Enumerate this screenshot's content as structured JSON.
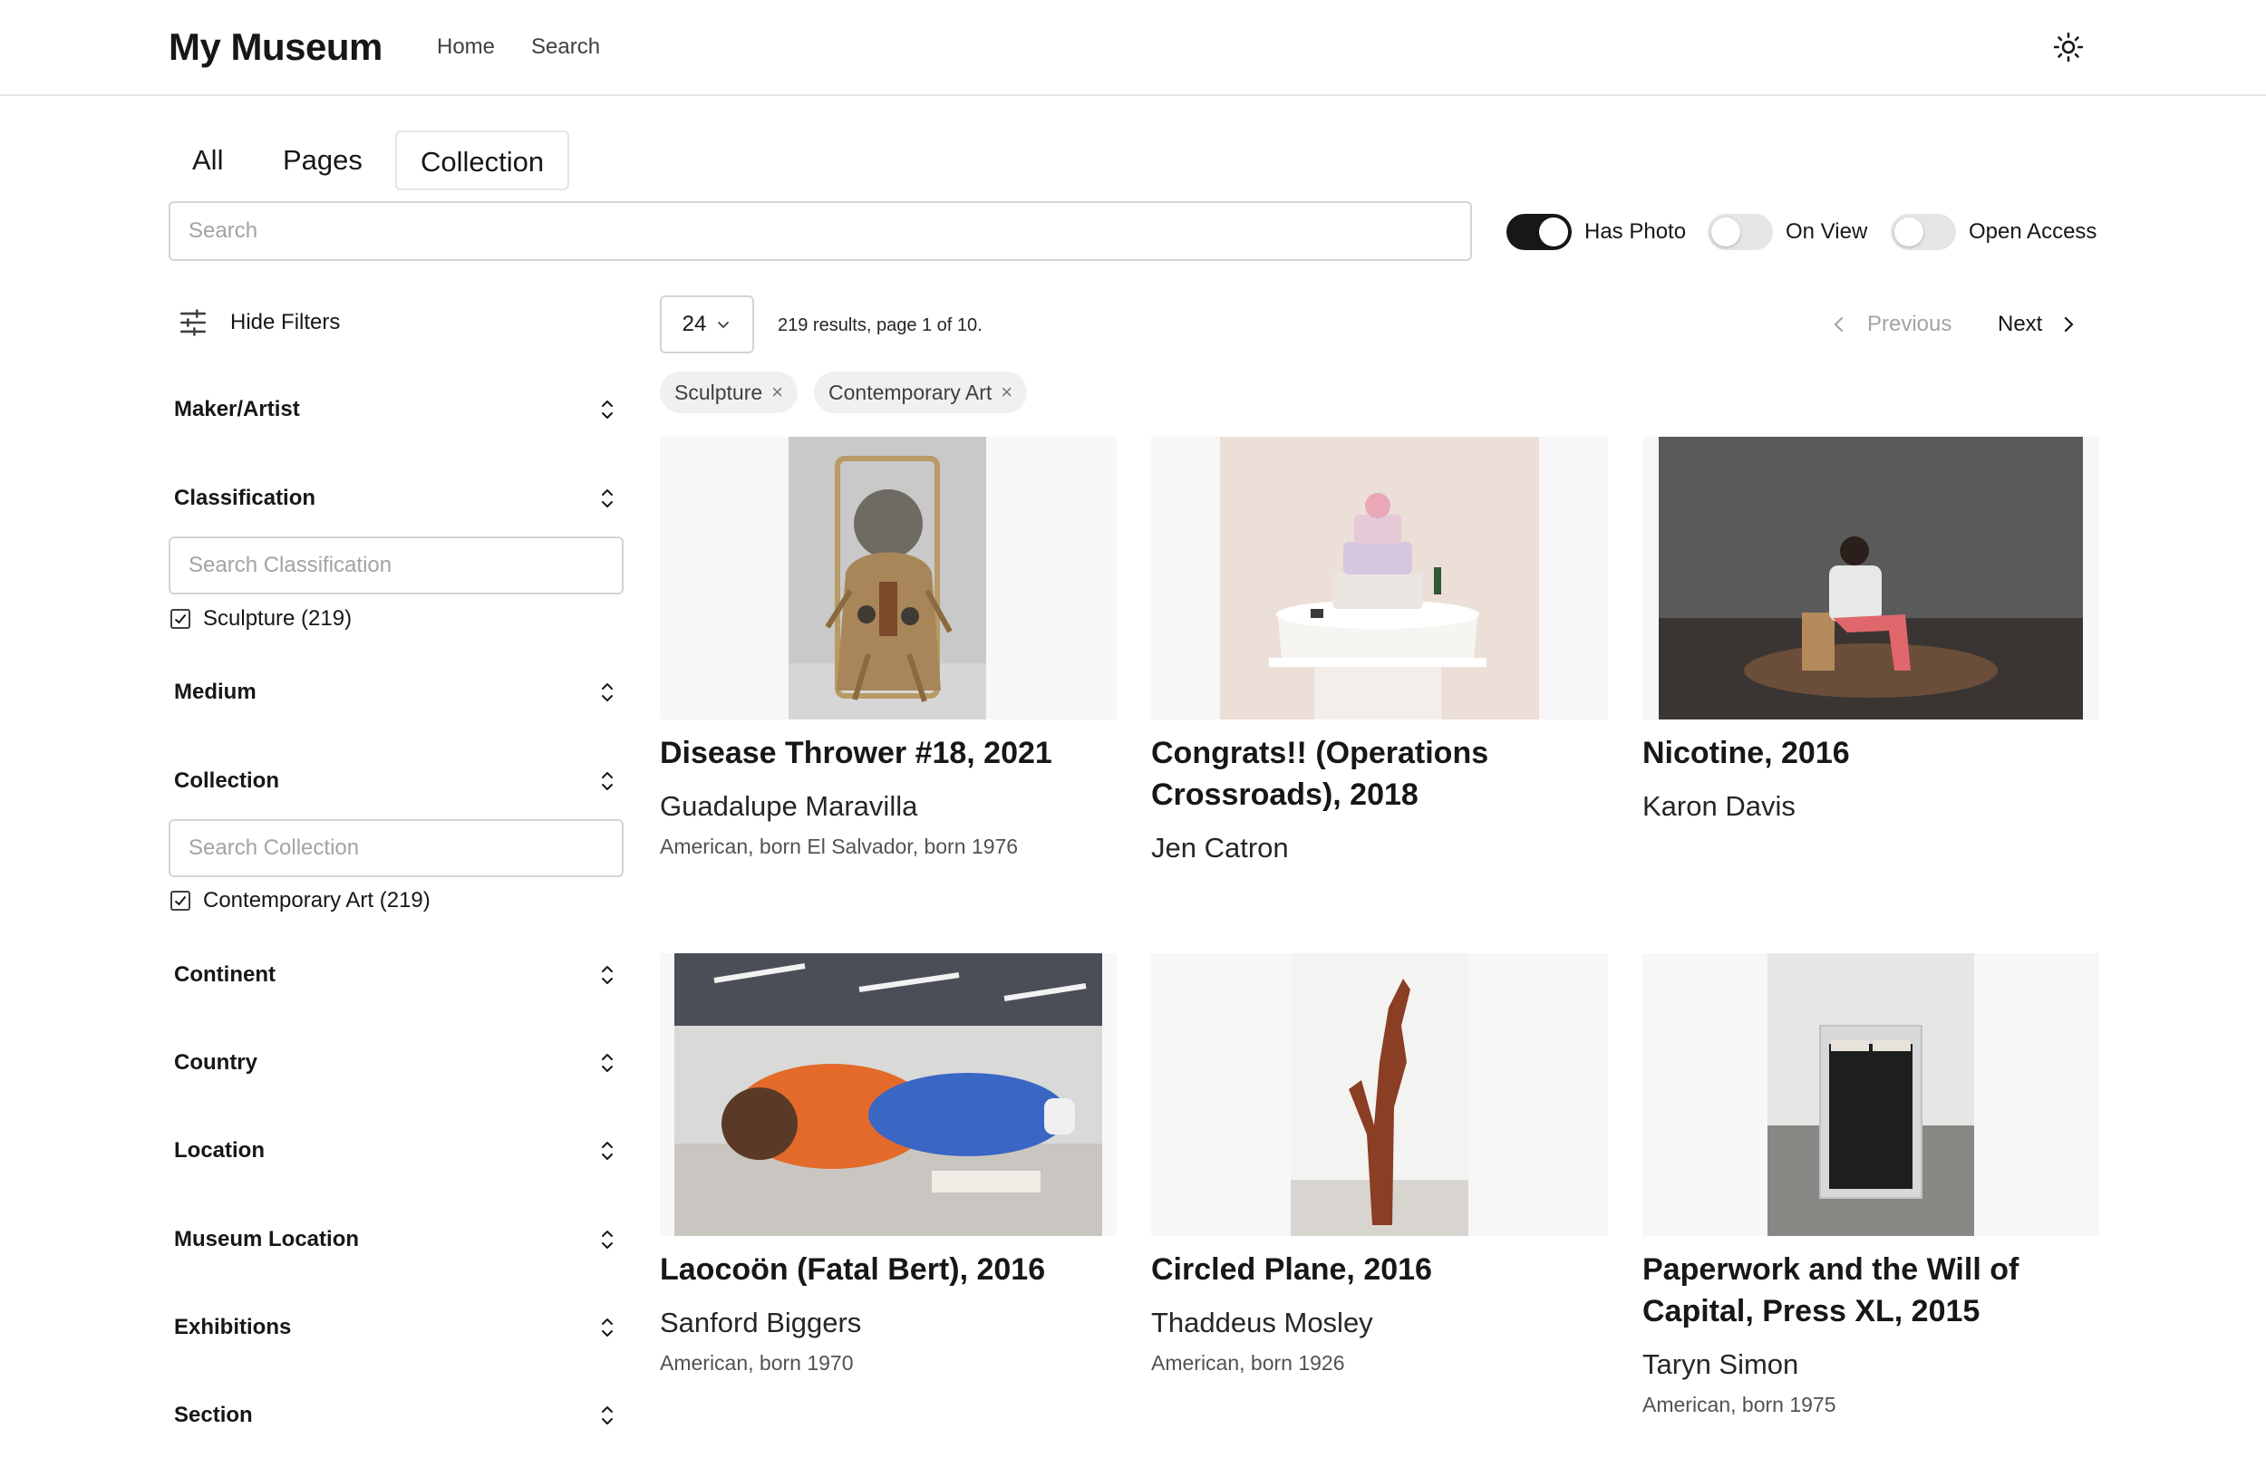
{
  "header": {
    "logo": "My Museum",
    "nav": [
      "Home",
      "Search"
    ]
  },
  "tabs": [
    "All",
    "Pages",
    "Collection"
  ],
  "active_tab": "Collection",
  "search": {
    "placeholder": "Search",
    "value": ""
  },
  "toggles": [
    {
      "label": "Has Photo",
      "on": true
    },
    {
      "label": "On View",
      "on": false
    },
    {
      "label": "Open Access",
      "on": false
    }
  ],
  "sidebar": {
    "hide_filters_label": "Hide Filters",
    "facets": [
      "Maker/Artist",
      "Classification",
      "Medium",
      "Collection",
      "Continent",
      "Country",
      "Location",
      "Museum Location",
      "Exhibitions",
      "Section"
    ],
    "classification": {
      "placeholder": "Search Classification",
      "option": "Sculpture (219)",
      "checked": true
    },
    "collection": {
      "placeholder": "Search Collection",
      "option": "Contemporary Art (219)",
      "checked": true
    }
  },
  "results": {
    "per_page": "24",
    "info": "219 results, page 1 of 10.",
    "previous_label": "Previous",
    "next_label": "Next",
    "chips": [
      "Sculpture",
      "Contemporary Art"
    ]
  },
  "cards": [
    {
      "title": "Disease Thrower #18, 2021",
      "maker": "Guadalupe Maravilla",
      "bio": "American, born El Salvador, born 1976"
    },
    {
      "title": "Congrats!! (Operations Crossroads), 2018",
      "maker": "Jen Catron",
      "bio": ""
    },
    {
      "title": "Nicotine, 2016",
      "maker": "Karon Davis",
      "bio": ""
    },
    {
      "title": "Laocoön (Fatal Bert), 2016",
      "maker": "Sanford Biggers",
      "bio": "American, born 1970"
    },
    {
      "title": "Circled Plane, 2016",
      "maker": "Thaddeus Mosley",
      "bio": "American, born 1926"
    },
    {
      "title": "Paperwork and the Will of Capital, Press XL, 2015",
      "maker": "Taryn Simon",
      "bio": "American, born 1975"
    }
  ],
  "icons": {
    "theme": "sun-icon",
    "filters": "sliders-icon",
    "facet_toggle": "chevron-up-down-icon",
    "chip_remove": "x-icon",
    "per_page": "chevron-down-icon",
    "previous": "chevron-left-icon",
    "next": "chevron-right-icon",
    "checkbox": "check-icon"
  },
  "colors": {
    "toggle_on": "#171717",
    "toggle_off": "#e5e5e5",
    "chip_bg": "#f0f0f0",
    "disabled_text": "#a3a3a3"
  }
}
